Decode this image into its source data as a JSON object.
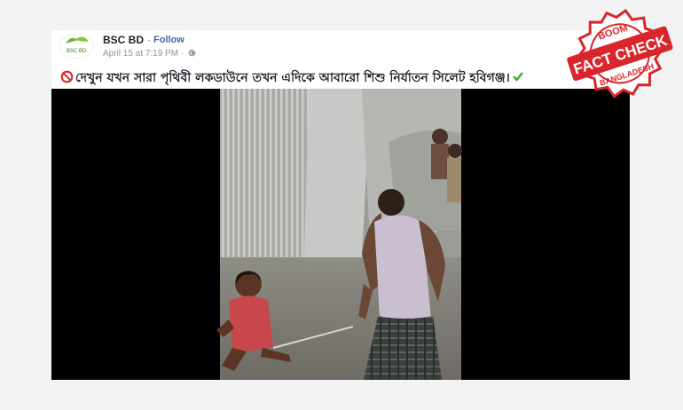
{
  "post": {
    "page_name": "BSC BD",
    "separator": "·",
    "follow_label": "Follow",
    "timestamp": "April 15 at 7:19 PM",
    "meta_separator": "·",
    "avatar_text": "BSC BD",
    "text": "দেখুন যখন সারা পৃথিবী লকডাউনে তখন এদিকে আবারো শিশু নির্যাতন সিলেট হবিগঞ্জ।",
    "prefix_icon": "no-entry-icon",
    "suffix_icon": "check-mark-icon"
  },
  "stamp": {
    "top": "BOOM",
    "main": "FACT CHECK",
    "bottom": "BANGLADESH",
    "color": "#d9262c"
  },
  "colors": {
    "background": "#f3f3f3",
    "card": "#ffffff",
    "link": "#4267b2",
    "text": "#1d2129",
    "muted": "#90949c"
  }
}
